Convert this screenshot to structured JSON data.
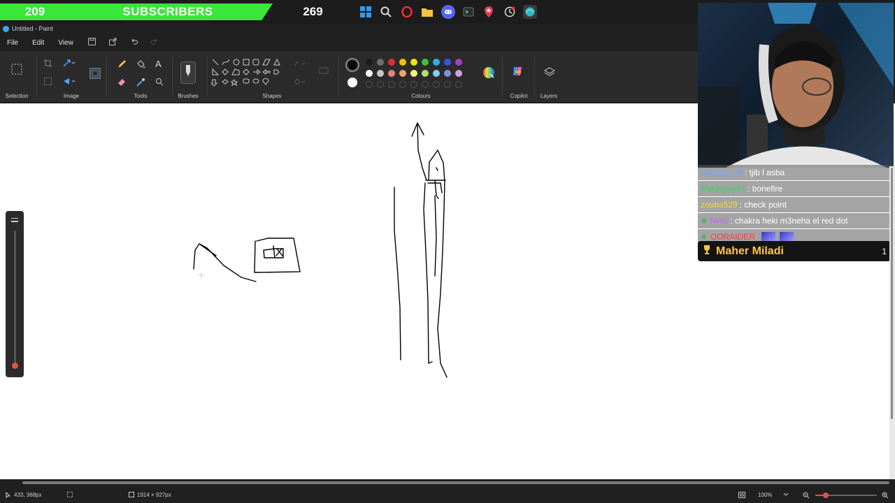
{
  "taskbar": {
    "subscriber_count": "209",
    "subscriber_label": "SUBSCRIBERS",
    "secondary_count": "269",
    "icons": [
      "windows-icon",
      "search-icon",
      "opera-icon",
      "folder-icon",
      "discord-icon",
      "terminal-icon",
      "maps-pin-icon",
      "clock-icon",
      "edge-icon"
    ]
  },
  "window": {
    "title": "Untitled - Paint"
  },
  "menu": {
    "file": "File",
    "edit": "Edit",
    "view": "View"
  },
  "ribbon": {
    "groups": {
      "selection": "Selection",
      "image": "Image",
      "tools": "Tools",
      "brushes": "Brushes",
      "shapes": "Shapes",
      "colours": "Colours",
      "copilot": "Copilot",
      "layers": "Layers"
    },
    "colours_row1": [
      "#1a1a1a",
      "#6f6f6f",
      "#e0303a",
      "#f0c000",
      "#e8e800",
      "#40c040",
      "#30b0e0",
      "#4050e0",
      "#a040c0"
    ],
    "colours_row2": [
      "#ffffff",
      "#c8c8c8",
      "#f08080",
      "#f0a070",
      "#f5f080",
      "#b0e070",
      "#80d0f0",
      "#8090e0",
      "#d0a0e0"
    ],
    "primary_colour": "#000000",
    "secondary_colour": "#ffffff"
  },
  "chat": {
    "messages": [
      {
        "user": "dagdeg_off",
        "text": ": tjib l asba",
        "color": "#6fa8ff"
      },
      {
        "user": "shaddyyy07",
        "text": ": bonefire",
        "color": "#39d353"
      },
      {
        "user": "zouba529",
        "text": ": check point",
        "color": "#ffd23c"
      },
      {
        "user": "f4nci",
        "text": ": chakra heki m3neha el red dot",
        "color": "#c264ff"
      },
      {
        "user": "OORAIDER",
        "text": "",
        "color": "#ff3b3b"
      }
    ]
  },
  "gift": {
    "name": "Maher Miladi",
    "count": "1"
  },
  "status": {
    "cursor": "433, 368px",
    "canvas_size": "1914 × 927px",
    "zoom": "100%"
  }
}
